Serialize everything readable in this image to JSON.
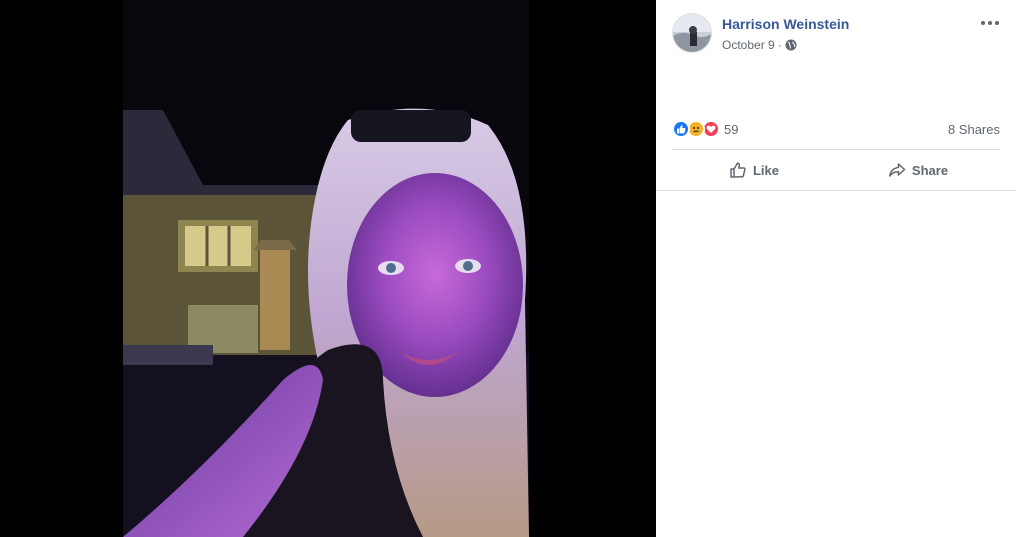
{
  "photo": {
    "alt": "Selfie at night with purple lighting",
    "icon": "photo"
  },
  "post": {
    "author": "Harrison Weinstein",
    "date": "October 9",
    "separator": "·",
    "privacy_icon": "globe-icon",
    "menu_icon": "more-options-icon"
  },
  "reactions": {
    "types": [
      "like",
      "sad",
      "love"
    ],
    "count": "59",
    "shares": "8 Shares"
  },
  "actions": {
    "like_label": "Like",
    "share_label": "Share"
  },
  "colors": {
    "link": "#385898",
    "secondary_text": "#606770",
    "like": "#1877f2",
    "sad": "#f7b125",
    "love": "#f33e58",
    "divider": "#dadde1"
  }
}
